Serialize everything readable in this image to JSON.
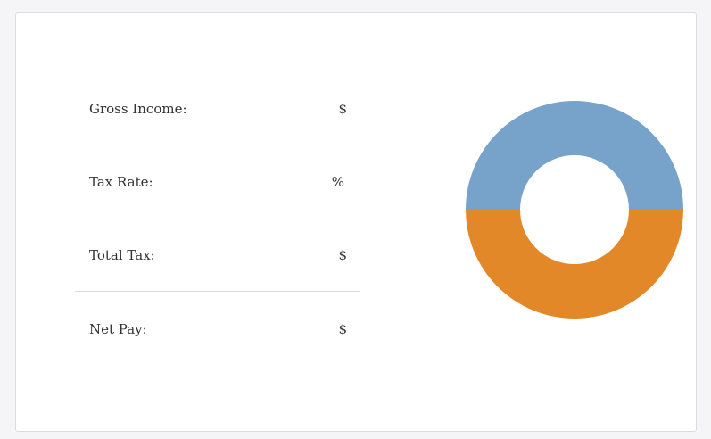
{
  "summary": {
    "gross_income": {
      "label": "Gross Income:",
      "unit": "$"
    },
    "tax_rate": {
      "label": "Tax Rate:",
      "unit": "%"
    },
    "total_tax": {
      "label": "Total Tax:",
      "unit": "$"
    },
    "net_pay": {
      "label": "Net Pay:",
      "unit": "$"
    }
  },
  "chart_data": {
    "type": "pie",
    "donut": true,
    "title": "",
    "series": [
      {
        "values": [
          50
        ],
        "color": "#77a3ca"
      },
      {
        "values": [
          50
        ],
        "color": "#e38828"
      }
    ]
  }
}
